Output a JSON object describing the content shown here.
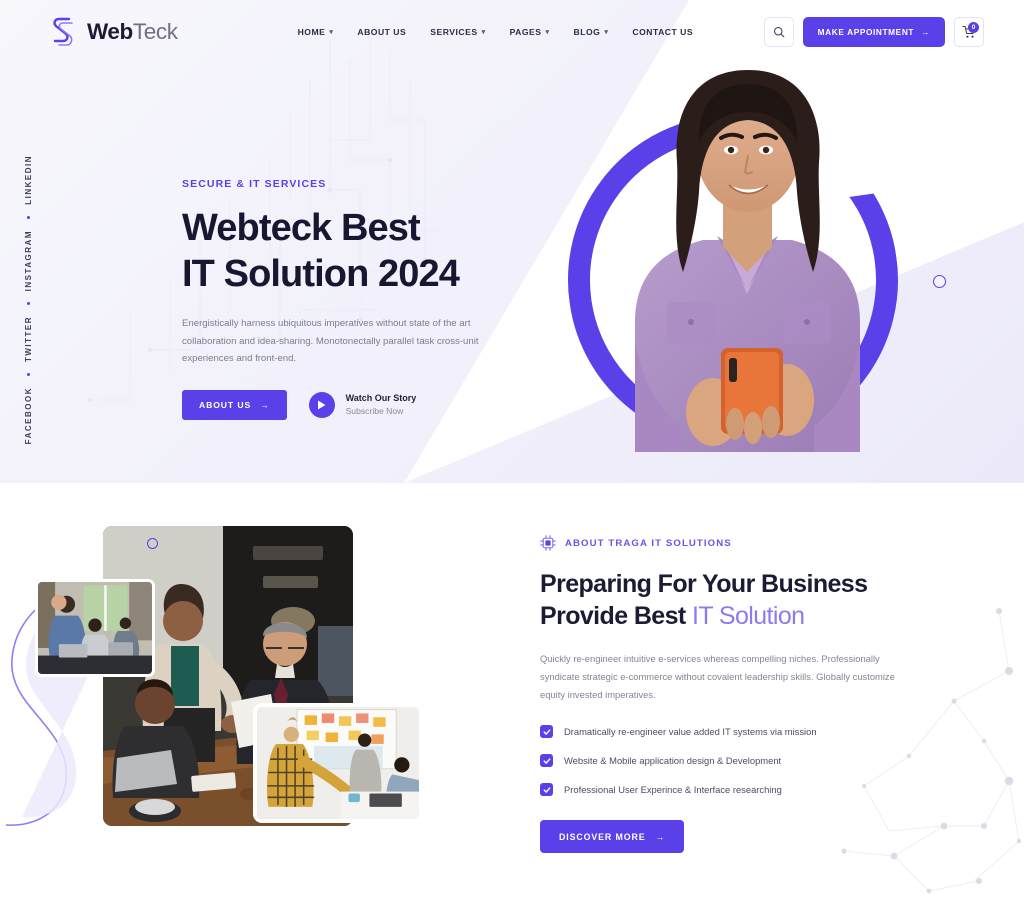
{
  "brand": {
    "name_bold": "Web",
    "name_light": "Teck",
    "accent_color": "#5A40E8",
    "accent_light": "#8C7BF0",
    "logo_icon": "webteck-s-logo-icon"
  },
  "header": {
    "nav": [
      {
        "label": "HOME",
        "has_dropdown": true
      },
      {
        "label": "ABOUT US",
        "has_dropdown": false
      },
      {
        "label": "SERVICES",
        "has_dropdown": true
      },
      {
        "label": "PAGES",
        "has_dropdown": true
      },
      {
        "label": "BLOG",
        "has_dropdown": true
      },
      {
        "label": "CONTACT US",
        "has_dropdown": false
      }
    ],
    "search_icon": "search-icon",
    "appointment_label": "MAKE APPOINTMENT",
    "appointment_arrow": "→",
    "cart_icon": "shopping-cart-icon",
    "cart_count": "0"
  },
  "social": {
    "items": [
      "FACEBOOK",
      "TWITTER",
      "INSTAGRAM",
      "LINKEDIN"
    ]
  },
  "hero": {
    "eyebrow": "SECURE & IT SERVICES",
    "title_line1": "Webteck Best",
    "title_line2": "IT Solution 2024",
    "description": "Energistically harness ubiquitous imperatives without state of the art collaboration and idea-sharing. Monotonectally parallel task cross-unit experiences and front-end.",
    "cta_label": "ABOUT US",
    "cta_arrow": "→",
    "watch_title": "Watch Our Story",
    "watch_subtitle": "Subscribe Now",
    "play_icon": "play-icon",
    "image_alt": "smiling-woman-holding-phone"
  },
  "about": {
    "eyebrow": "ABOUT TRAGA IT SOLUTIONS",
    "eyebrow_icon": "chip-processor-icon",
    "title_line1": "Preparing For Your Business",
    "title_line2_plain": "Provide Best ",
    "title_line2_accent": "IT Solution",
    "description": "Quickly re-engineer intuitive e-services whereas compelling niches. Professionally syndicate strategic e-commerce without covalent leadership skills. Globally customize equity invested imperatives.",
    "checklist": [
      "Dramatically re-engineer value added IT systems via mission",
      "Website & Mobile application design & Development",
      "Professional User Experince & Interface researching"
    ],
    "cta_label": "DISCOVER MORE",
    "cta_arrow": "→",
    "images": [
      "team-meeting-office-main",
      "coworkers-at-desk-small",
      "whiteboard-brainstorm-small"
    ]
  }
}
